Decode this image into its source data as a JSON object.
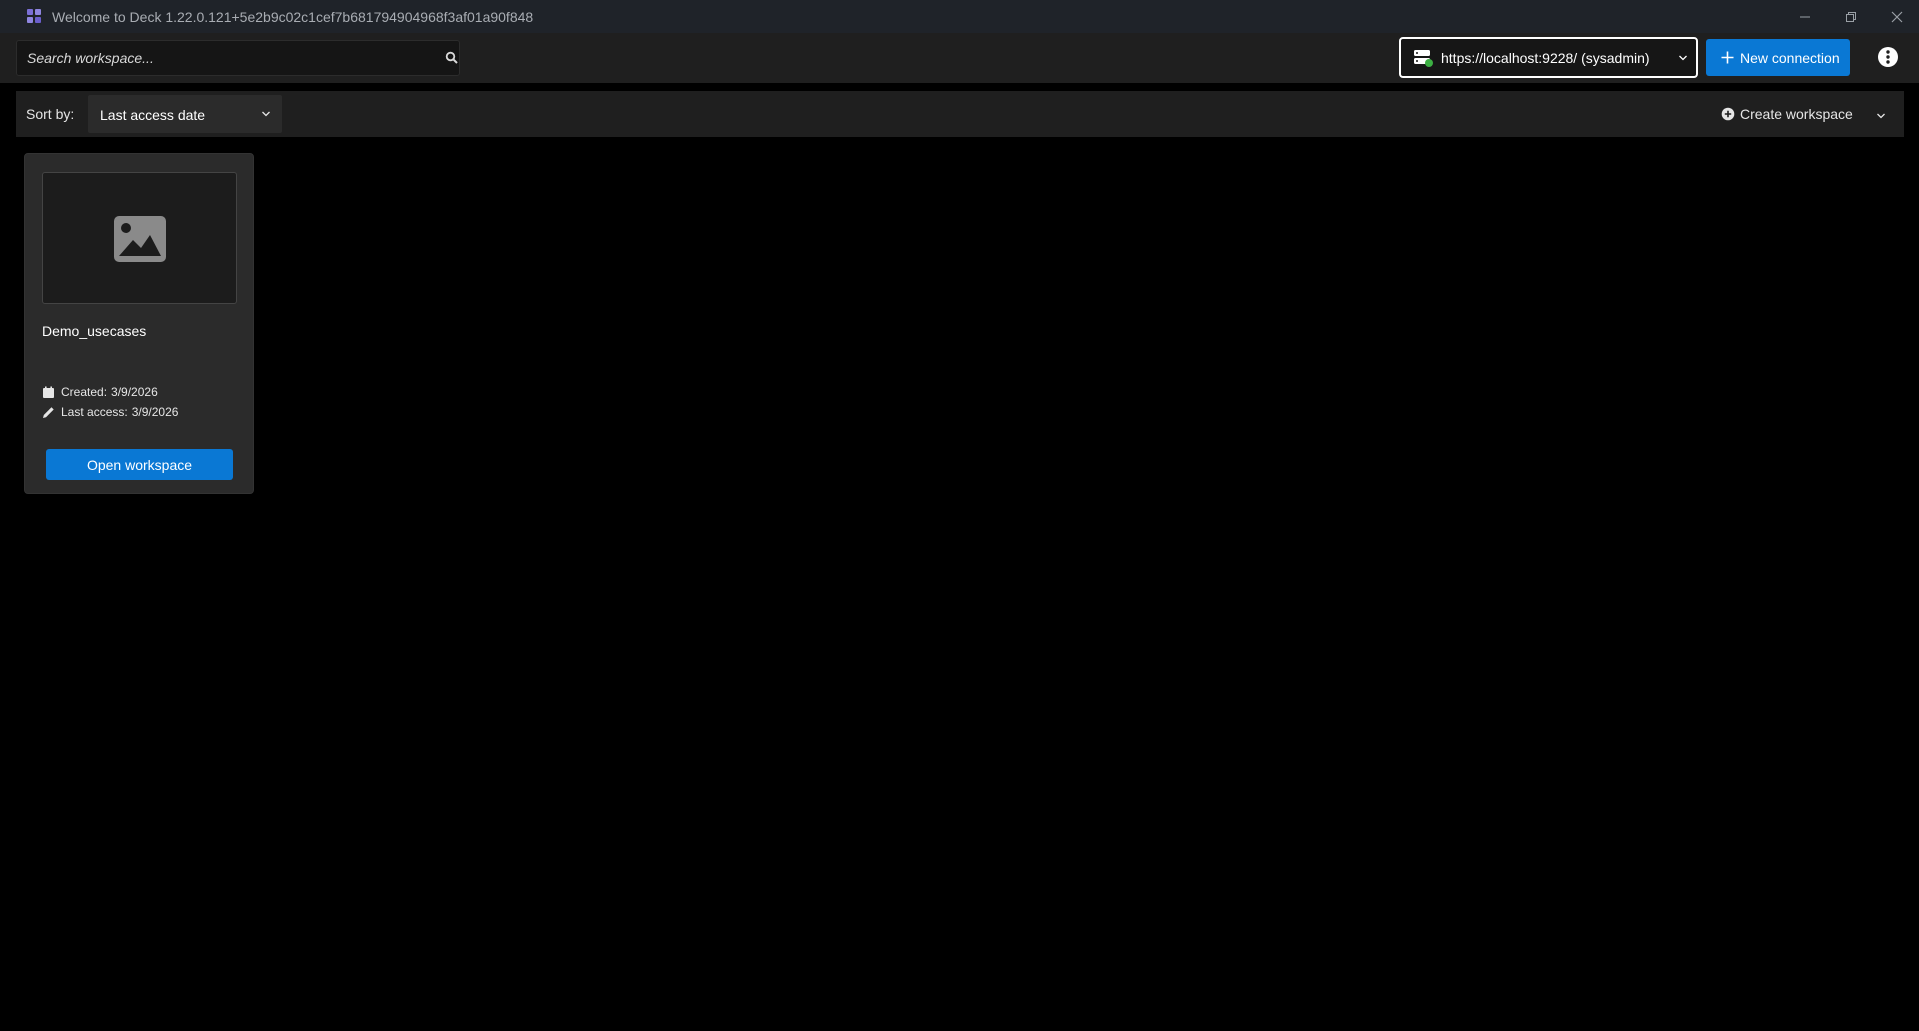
{
  "window": {
    "title": "Welcome to Deck 1.22.0.121+5e2b9c02c1cef7b681794904968f3af01a90f848",
    "app_icon": "grid-icon",
    "controls": [
      "minimize-icon",
      "maximize-icon",
      "close-icon"
    ]
  },
  "toolbar": {
    "search": {
      "placeholder": "Search workspace...",
      "value": "",
      "icon": "search-icon"
    },
    "connection": {
      "label": "https://localhost:9228/ (sysadmin)",
      "icon": "server-icon",
      "status_color": "#3cb043"
    },
    "new_connection_label": "New connection",
    "info_icon": "info-icon"
  },
  "sortbar": {
    "sort_label": "Sort by:",
    "sort_value": "Last access date",
    "create_workspace_label": "Create workspace"
  },
  "workspaces": [
    {
      "name": "Demo_usecases",
      "thumbnail_icon": "image-placeholder-icon",
      "created_label": "Created:",
      "created_value": "3/9/2026",
      "last_access_label": "Last access:",
      "last_access_value": "3/9/2026",
      "open_label": "Open workspace"
    }
  ],
  "colors": {
    "accent": "#0a78d4",
    "background": "#000000",
    "panel": "#1f1f1f",
    "card": "#2b2b2b"
  }
}
